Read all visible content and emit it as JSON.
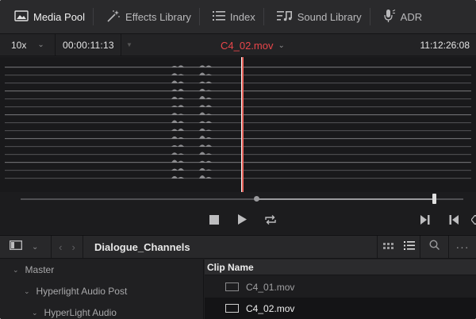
{
  "toolbar": {
    "tabs": [
      {
        "label": "Media Pool",
        "icon": "media-pool-icon",
        "active": true
      },
      {
        "label": "Effects Library",
        "icon": "effects-wand-icon",
        "active": false
      },
      {
        "label": "Index",
        "icon": "index-list-icon",
        "active": false
      },
      {
        "label": "Sound Library",
        "icon": "sound-library-icon",
        "active": false
      },
      {
        "label": "ADR",
        "icon": "microphone-icon",
        "active": false
      }
    ]
  },
  "viewer": {
    "zoom": "10x",
    "timecode_in": "00:00:11:13",
    "clip_name": "C4_02.mov",
    "timecode_current": "11:12:26:08",
    "accent_color": "#e9464a",
    "scrub_position": 0.87
  },
  "browser": {
    "bin_title": "Dialogue_Channels",
    "tree": [
      {
        "label": "Master",
        "level": 0
      },
      {
        "label": "Hyperlight Audio Post",
        "level": 1
      },
      {
        "label": "HyperLight Audio",
        "level": 2
      }
    ],
    "columns": {
      "clip_name": "Clip Name"
    },
    "clips": [
      {
        "name": "C4_01.mov",
        "selected": false
      },
      {
        "name": "C4_02.mov",
        "selected": true
      }
    ]
  }
}
